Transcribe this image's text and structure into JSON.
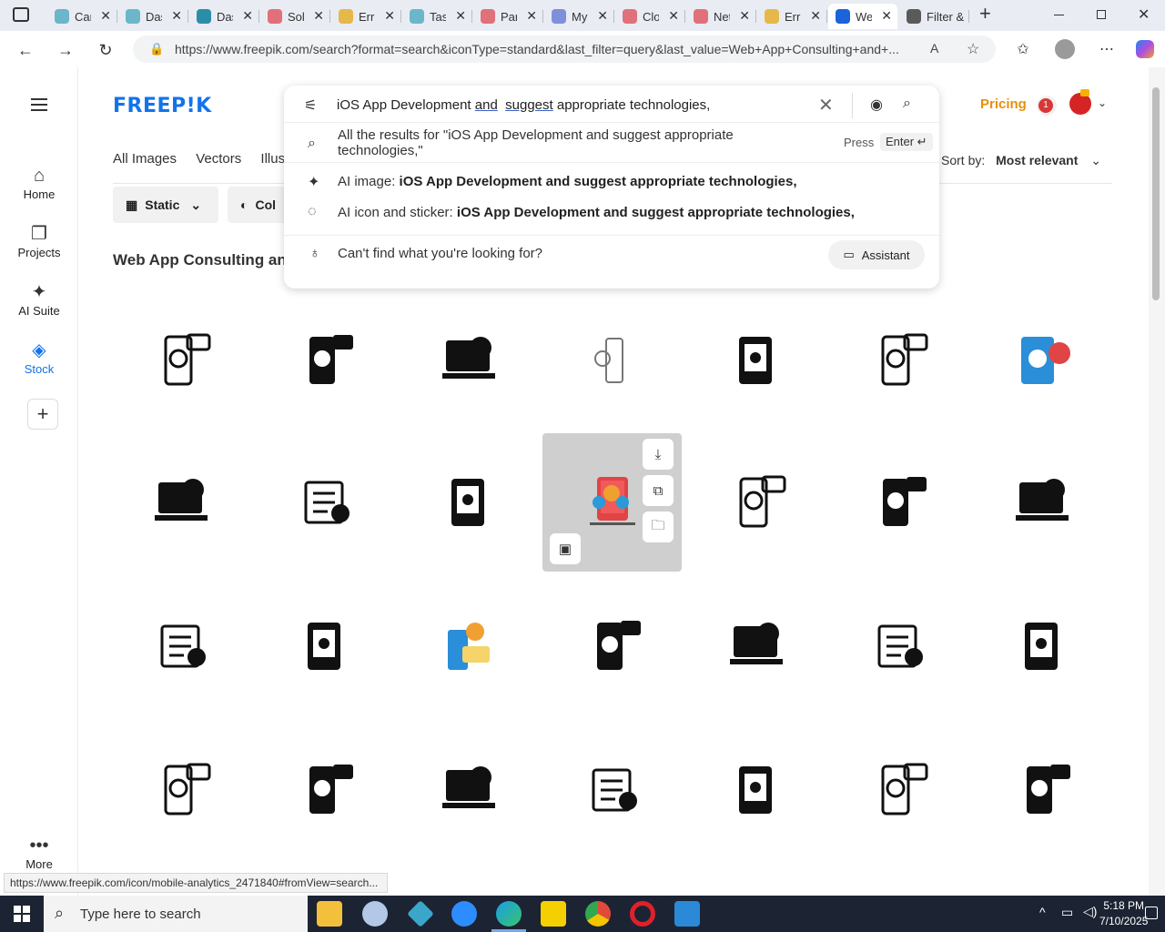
{
  "browser": {
    "tabs": [
      {
        "label": "Car",
        "color": "#6bb6c9"
      },
      {
        "label": "Das",
        "color": "#6bb6c9"
      },
      {
        "label": "Das",
        "color": "#2a8ea8"
      },
      {
        "label": "Sol",
        "color": "#e0707a"
      },
      {
        "label": "Erro",
        "color": "#e6b84a"
      },
      {
        "label": "Tas",
        "color": "#6bb6c9"
      },
      {
        "label": "Par",
        "color": "#e0707a"
      },
      {
        "label": "My",
        "color": "#7f8fd9"
      },
      {
        "label": "Clo",
        "color": "#e0707a"
      },
      {
        "label": "Net",
        "color": "#e0707a"
      },
      {
        "label": "Erro",
        "color": "#e6b84a"
      },
      {
        "label": "We",
        "color": "#1a63d8"
      },
      {
        "label": "Filter &",
        "color": "#5a5a5a"
      }
    ],
    "new_tab": "+",
    "url": "https://www.freepik.com/search?format=search&iconType=standard&last_filter=query&last_value=Web+App+Consulting+and+..."
  },
  "sidebar": {
    "items": [
      {
        "label": "Home",
        "icon": "home-icon",
        "glyph": "⌂"
      },
      {
        "label": "Projects",
        "icon": "projects-icon",
        "glyph": "❐"
      },
      {
        "label": "AI Suite",
        "icon": "ai-suite-icon",
        "glyph": "✦"
      },
      {
        "label": "Stock",
        "icon": "stock-icon",
        "glyph": "◈"
      }
    ],
    "add": "+",
    "more": "More"
  },
  "header": {
    "logo": "FREEP!K",
    "pricing": "Pricing",
    "notifications": "1"
  },
  "search": {
    "query_prefix": "iOS App Development ",
    "query_u1": "and",
    "query_mid": "  ",
    "query_u2": "suggest",
    "query_suffix": " appropriate technologies,",
    "all_results_line1": "All the results for \"iOS App Development and suggest appropriate",
    "all_results_line2": "technologies,\"",
    "press": "Press",
    "enter": "Enter ↵",
    "ai_image_prefix": "AI image: ",
    "ai_image_query": "iOS App Development and suggest appropriate technologies,",
    "ai_icon_prefix": "AI icon and sticker: ",
    "ai_icon_query": "iOS App Development and suggest appropriate technologies,",
    "cant_find": "Can't find what you're looking for?",
    "assistant": "Assistant"
  },
  "filters": {
    "tabs": [
      "All Images",
      "Vectors",
      "Illus"
    ],
    "sort_label": "Sort by:",
    "sort_value": "Most relevant",
    "chips": [
      "Static",
      "Col"
    ]
  },
  "page_heading": "Web App Consulting and",
  "status_url": "https://www.freepik.com/icon/mobile-analytics_2471840#fromView=search...",
  "taskbar": {
    "search_placeholder": "Type here to search",
    "time": "5:18 PM",
    "date": "7/10/2025"
  }
}
